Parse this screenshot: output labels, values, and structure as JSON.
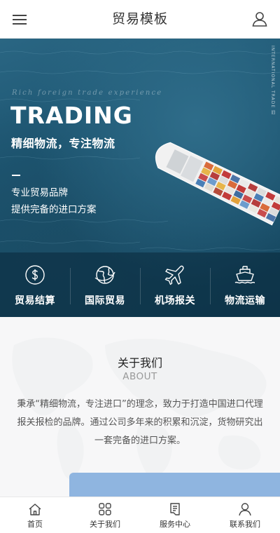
{
  "header": {
    "title": "贸易模板",
    "menu_icon": "hamburger-menu-icon",
    "user_icon": "user-icon"
  },
  "hero": {
    "side_text": "INTERNATIONAL TRADE 旧",
    "kicker": "Rich foreign trade experience",
    "headline": "TRADING",
    "slogan": "精细物流，专注物流",
    "line1": "专业贸易品牌",
    "line2": "提供完备的进口方案"
  },
  "services": [
    {
      "label": "贸易结算",
      "icon": "dollar-coin-icon"
    },
    {
      "label": "国际贸易",
      "icon": "globe-icon"
    },
    {
      "label": "机场报关",
      "icon": "airplane-icon"
    },
    {
      "label": "物流运输",
      "icon": "ship-icon"
    }
  ],
  "about": {
    "title": "关于我们",
    "subtitle": "ABOUT",
    "description": "秉承“精细物流，专注进口”的理念，致力于打造中国进口代理报关报检的品牌。通过公司多年来的积累和沉淀，货物研究出一套完备的进口方案。"
  },
  "bottom_nav": [
    {
      "label": "首页",
      "icon": "home-icon"
    },
    {
      "label": "关于我们",
      "icon": "grid-icon"
    },
    {
      "label": "服务中心",
      "icon": "document-icon"
    },
    {
      "label": "联系我们",
      "icon": "contact-user-icon"
    }
  ],
  "colors": {
    "sea": "#1d5672",
    "accent_card": "#8fb5e0"
  }
}
